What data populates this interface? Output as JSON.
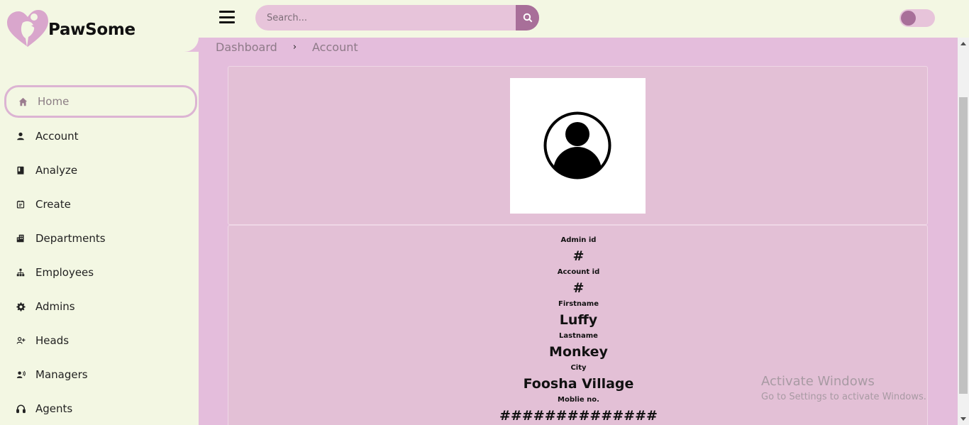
{
  "app": {
    "name": "PawSome"
  },
  "colors": {
    "accent": "#a86f99",
    "panel": "#e4bddc",
    "background": "#f3f7e3",
    "search": "#e7c4da"
  },
  "sidebar": {
    "items": [
      {
        "label": "Home",
        "icon": "home-icon",
        "active": true
      },
      {
        "label": "Account",
        "icon": "person-icon"
      },
      {
        "label": "Analyze",
        "icon": "book-icon"
      },
      {
        "label": "Create",
        "icon": "calendar-icon"
      },
      {
        "label": "Departments",
        "icon": "building-icon"
      },
      {
        "label": "Employees",
        "icon": "org-chart-icon"
      },
      {
        "label": "Admins",
        "icon": "gear-icon"
      },
      {
        "label": "Heads",
        "icon": "person-add-icon"
      },
      {
        "label": "Managers",
        "icon": "person-voice-icon"
      },
      {
        "label": "Agents",
        "icon": "headset-icon"
      }
    ]
  },
  "topbar": {
    "search_placeholder": "Search...",
    "search_icon": "search-icon",
    "menu_icon": "hamburger-icon"
  },
  "breadcrumb": {
    "items": [
      "Dashboard",
      "Account"
    ],
    "separator": "›"
  },
  "profile": {
    "avatar_icon": "user-circle-icon",
    "fields": [
      {
        "label": "Admin id",
        "value": "#"
      },
      {
        "label": "Account id",
        "value": "#"
      },
      {
        "label": "Firstname",
        "value": "Luffy"
      },
      {
        "label": "Lastname",
        "value": "Monkey"
      },
      {
        "label": "City",
        "value": "Foosha Village"
      },
      {
        "label": "Moblie no.",
        "value": "##############"
      }
    ]
  },
  "watermark": {
    "line1": "Activate Windows",
    "line2": "Go to Settings to activate Windows."
  }
}
